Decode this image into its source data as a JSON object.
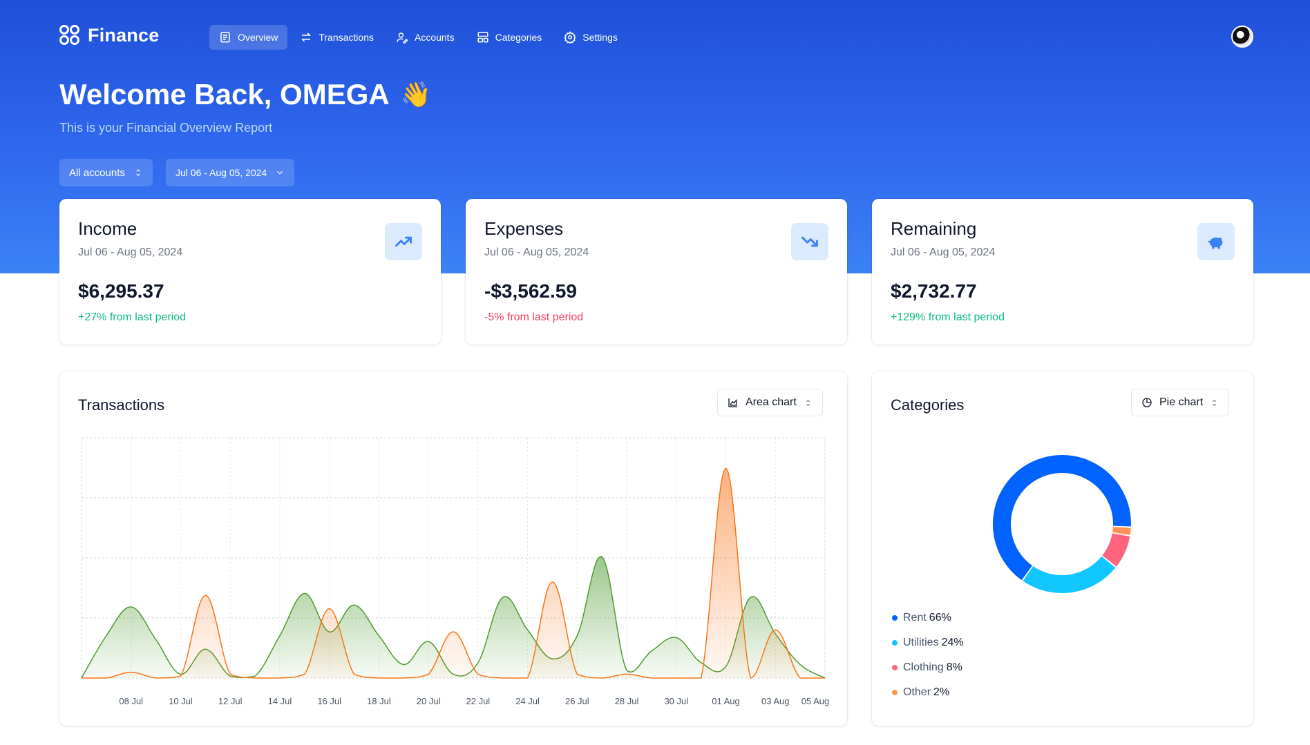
{
  "app": {
    "name": "Finance"
  },
  "nav": {
    "items": [
      {
        "label": "Overview",
        "icon": "overview-icon",
        "active": true
      },
      {
        "label": "Transactions",
        "icon": "transfer-icon",
        "active": false
      },
      {
        "label": "Accounts",
        "icon": "user-accounts-icon",
        "active": false
      },
      {
        "label": "Categories",
        "icon": "categories-icon",
        "active": false
      },
      {
        "label": "Settings",
        "icon": "gear-icon",
        "active": false
      }
    ]
  },
  "header": {
    "welcome": "Welcome Back, OMEGA",
    "wave_emoji": "👋",
    "subtitle": "This is your Financial Overview Report"
  },
  "filters": {
    "account": "All accounts",
    "date_range": "Jul 06 - Aug 05, 2024"
  },
  "stats": [
    {
      "title": "Income",
      "range": "Jul 06 - Aug 05, 2024",
      "value": "$6,295.37",
      "change": "+27% from last period",
      "change_color": "#10b981",
      "icon": "trending-up-icon"
    },
    {
      "title": "Expenses",
      "range": "Jul 06 - Aug 05, 2024",
      "value": "-$3,562.59",
      "change": "-5% from last period",
      "change_color": "#f43f5e",
      "icon": "trending-down-icon"
    },
    {
      "title": "Remaining",
      "range": "Jul 06 - Aug 05, 2024",
      "value": "$2,732.77",
      "change": "+129% from last period",
      "change_color": "#10b981",
      "icon": "piggy-bank-icon"
    }
  ],
  "transactions_panel": {
    "title": "Transactions",
    "chart_type_label": "Area chart"
  },
  "categories_panel": {
    "title": "Categories",
    "chart_type_label": "Pie chart"
  },
  "colors": {
    "income": "#4d9a2f",
    "expenses": "#f97316",
    "rent": "#0062ff",
    "utilities": "#12c6ff",
    "clothing": "#ff647f",
    "other": "#ff9354"
  },
  "chart_data": [
    {
      "type": "area",
      "title": "Transactions",
      "x": [
        "06 Jul",
        "07 Jul",
        "08 Jul",
        "09 Jul",
        "10 Jul",
        "11 Jul",
        "12 Jul",
        "13 Jul",
        "14 Jul",
        "15 Jul",
        "16 Jul",
        "17 Jul",
        "18 Jul",
        "19 Jul",
        "20 Jul",
        "21 Jul",
        "22 Jul",
        "23 Jul",
        "24 Jul",
        "25 Jul",
        "26 Jul",
        "27 Jul",
        "28 Jul",
        "29 Jul",
        "30 Jul",
        "31 Jul",
        "01 Aug",
        "02 Aug",
        "03 Aug",
        "04 Aug",
        "05 Aug"
      ],
      "x_tick_labels": [
        "08 Jul",
        "10 Jul",
        "12 Jul",
        "14 Jul",
        "16 Jul",
        "18 Jul",
        "20 Jul",
        "22 Jul",
        "24 Jul",
        "26 Jul",
        "28 Jul",
        "30 Jul",
        "01 Aug",
        "03 Aug",
        "05 Aug"
      ],
      "series": [
        {
          "name": "Income",
          "values": [
            0,
            220,
            370,
            200,
            20,
            150,
            10,
            10,
            220,
            440,
            240,
            380,
            220,
            70,
            190,
            20,
            80,
            420,
            250,
            100,
            220,
            630,
            40,
            140,
            210,
            80,
            60,
            420,
            230,
            70,
            0
          ]
        },
        {
          "name": "Expenses",
          "values": [
            0,
            0,
            30,
            0,
            10,
            430,
            20,
            0,
            0,
            20,
            360,
            20,
            0,
            0,
            20,
            240,
            20,
            0,
            0,
            500,
            20,
            0,
            20,
            0,
            0,
            0,
            1090,
            0,
            250,
            0,
            0
          ]
        }
      ],
      "ylim": [
        0,
        1250
      ],
      "grid": true,
      "legend": "none"
    },
    {
      "type": "pie",
      "title": "Categories",
      "categories": [
        "Rent",
        "Utilities",
        "Clothing",
        "Other"
      ],
      "values": [
        66,
        24,
        8,
        2
      ],
      "labels": [
        "66%",
        "24%",
        "8%",
        "2%"
      ],
      "donut": true
    }
  ]
}
